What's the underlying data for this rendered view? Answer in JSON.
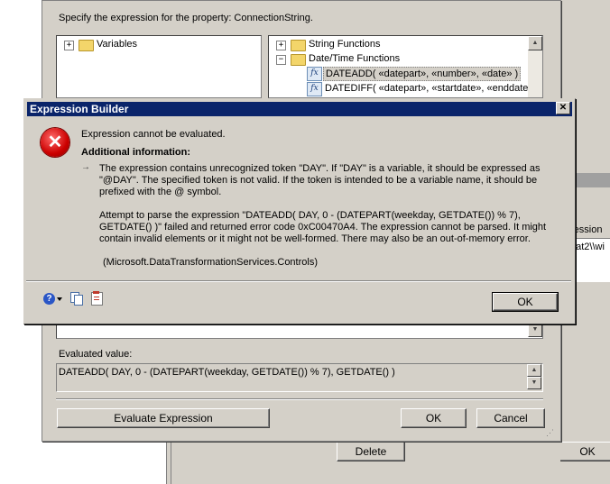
{
  "background": {
    "instruction": "Specify the expression for the property: ConnectionString.",
    "variables_label": "Variables",
    "functions": {
      "string_functions": "String Functions",
      "datetime_functions": "Date/Time Functions",
      "dateadd": "DATEADD( «datepart», «number», «date» )",
      "datediff": "DATEDIFF( «datepart», «startdate», «enddate»"
    },
    "evaluated_label": "Evaluated value:",
    "evaluated_value": "DATEADD( DAY, 0 - (DATEPART(weekday, GETDATE()) % 7), GETDATE() )",
    "evaluate_button": "Evaluate Expression",
    "ok_button": "OK",
    "cancel_button": "Cancel"
  },
  "right_window": {
    "column_header": "ression",
    "cell_value": "nat2\\\\wi",
    "ok_button": "OK"
  },
  "bottom_strip": {
    "delete_button": "Delete"
  },
  "dialog": {
    "title": "Expression Builder",
    "close_glyph": "✕",
    "headline": "Expression cannot be evaluated.",
    "additional_heading": "Additional information:",
    "arrow": "→",
    "para1_line1": "The expression contains unrecognized token \"DAY\". If \"DAY\" is a variable, it should be expressed as",
    "para1_line2": "\"@DAY\". The specified token is not valid. If the token is intended to be a variable name, it should be",
    "para1_line3": "prefixed with the @ symbol.",
    "para2_line1": "Attempt to parse the expression \"DATEADD( DAY, 0 - (DATEPART(weekday, GETDATE()) % 7),",
    "para2_line2": "GETDATE() )\" failed and returned error code 0xC00470A4. The expression cannot be parsed. It might",
    "para2_line3": "contain invalid elements or it might not be well-formed. There may also be an out-of-memory error.",
    "source": "(Microsoft.DataTransformationServices.Controls)",
    "ok_button": "OK",
    "error_glyph": "✕",
    "help_glyph": "?",
    "icons": [
      "help-icon",
      "copy-icon",
      "details-icon"
    ]
  }
}
